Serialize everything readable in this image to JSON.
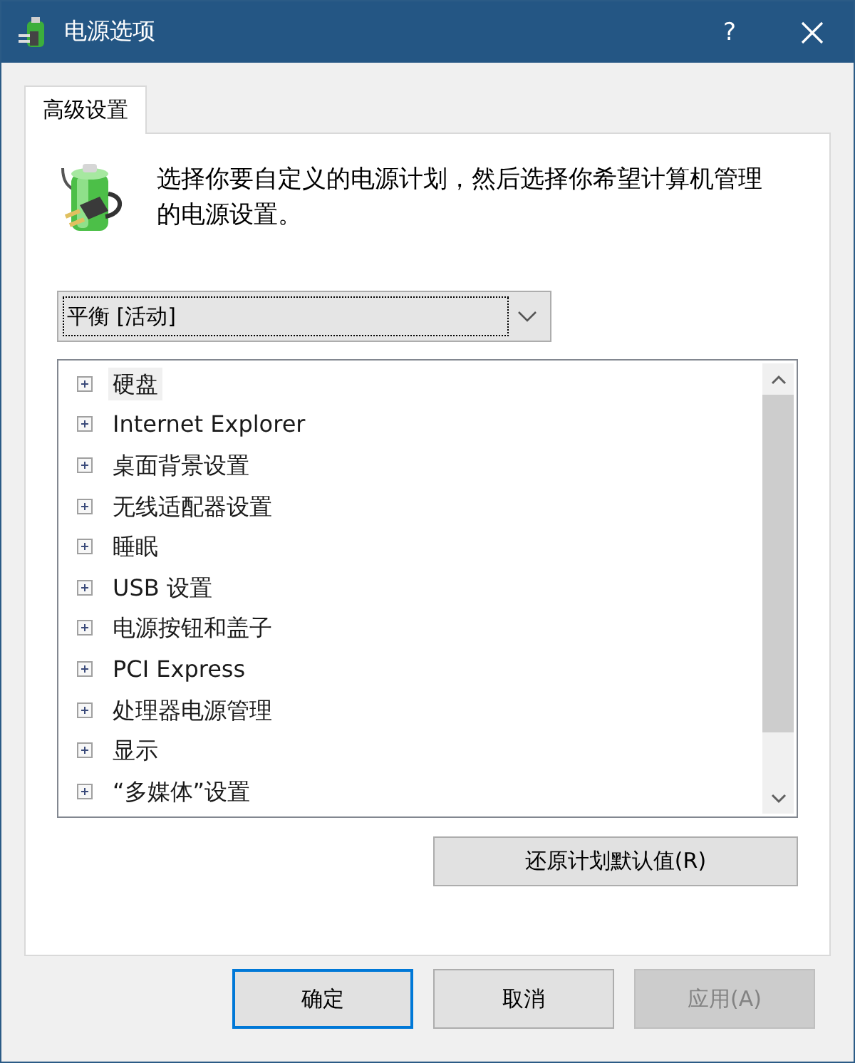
{
  "window": {
    "title": "电源选项",
    "help_button": "?"
  },
  "tabs": [
    {
      "label": "高级设置",
      "selected": true
    }
  ],
  "description": "选择你要自定义的电源计划，然后选择你希望计算机管理的电源设置。",
  "plan_dropdown": {
    "value": "平衡 [活动]"
  },
  "settings_tree": [
    {
      "label": "硬盘",
      "expanded": false,
      "selected": true
    },
    {
      "label": "Internet Explorer",
      "expanded": false,
      "selected": false
    },
    {
      "label": "桌面背景设置",
      "expanded": false,
      "selected": false
    },
    {
      "label": "无线适配器设置",
      "expanded": false,
      "selected": false
    },
    {
      "label": "睡眠",
      "expanded": false,
      "selected": false
    },
    {
      "label": "USB 设置",
      "expanded": false,
      "selected": false
    },
    {
      "label": "电源按钮和盖子",
      "expanded": false,
      "selected": false
    },
    {
      "label": "PCI Express",
      "expanded": false,
      "selected": false
    },
    {
      "label": "处理器电源管理",
      "expanded": false,
      "selected": false
    },
    {
      "label": "显示",
      "expanded": false,
      "selected": false
    },
    {
      "label": "“多媒体”设置",
      "expanded": false,
      "selected": false
    }
  ],
  "restore_button": {
    "label": "还原计划默认值(R)"
  },
  "buttons": [
    {
      "label": "确定",
      "default": true,
      "disabled": false
    },
    {
      "label": "取消",
      "default": false,
      "disabled": false
    },
    {
      "label": "应用(A)",
      "default": false,
      "disabled": true
    }
  ]
}
